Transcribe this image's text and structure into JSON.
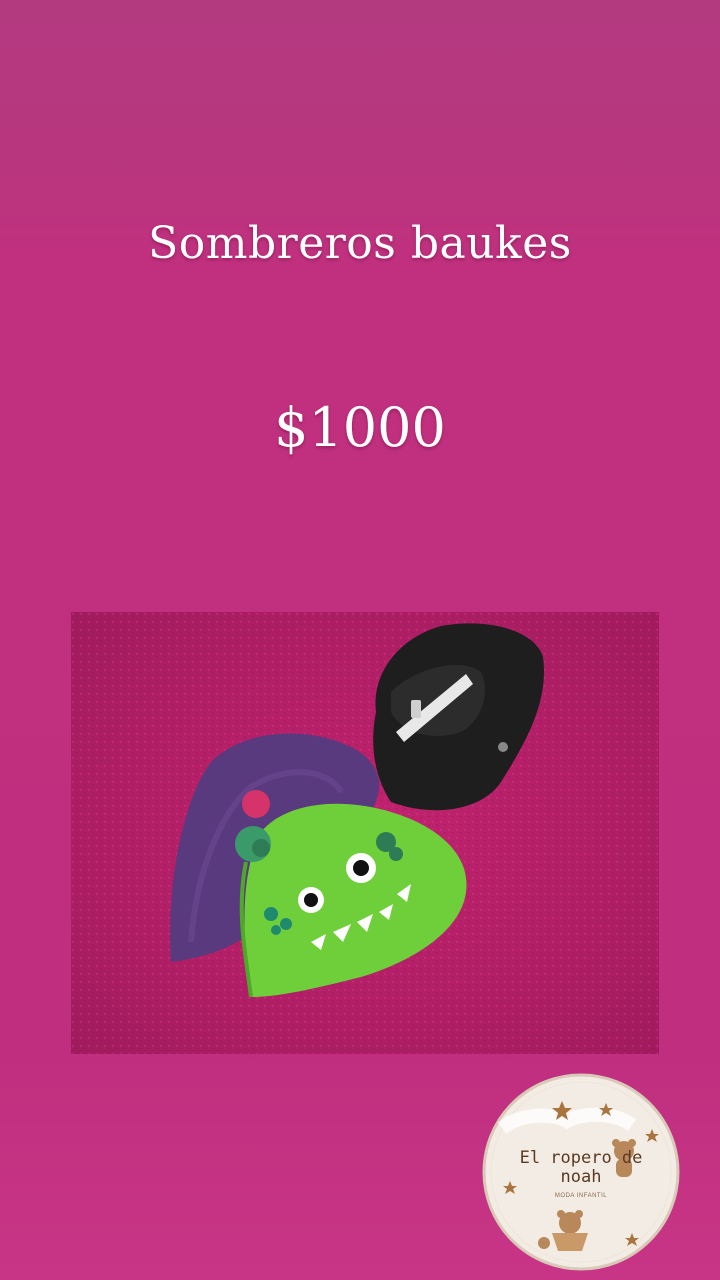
{
  "post": {
    "title": "Sombreros baukes",
    "price": "$1000"
  },
  "photo": {
    "subject": "product-photo-hats"
  },
  "logo": {
    "line1": "El ropero de",
    "line2": "noah",
    "tagline": "MODA INFANTIL"
  },
  "colors": {
    "background": "#c02f7f",
    "text": "#ffffff",
    "logo_bg": "#f3ece4"
  }
}
